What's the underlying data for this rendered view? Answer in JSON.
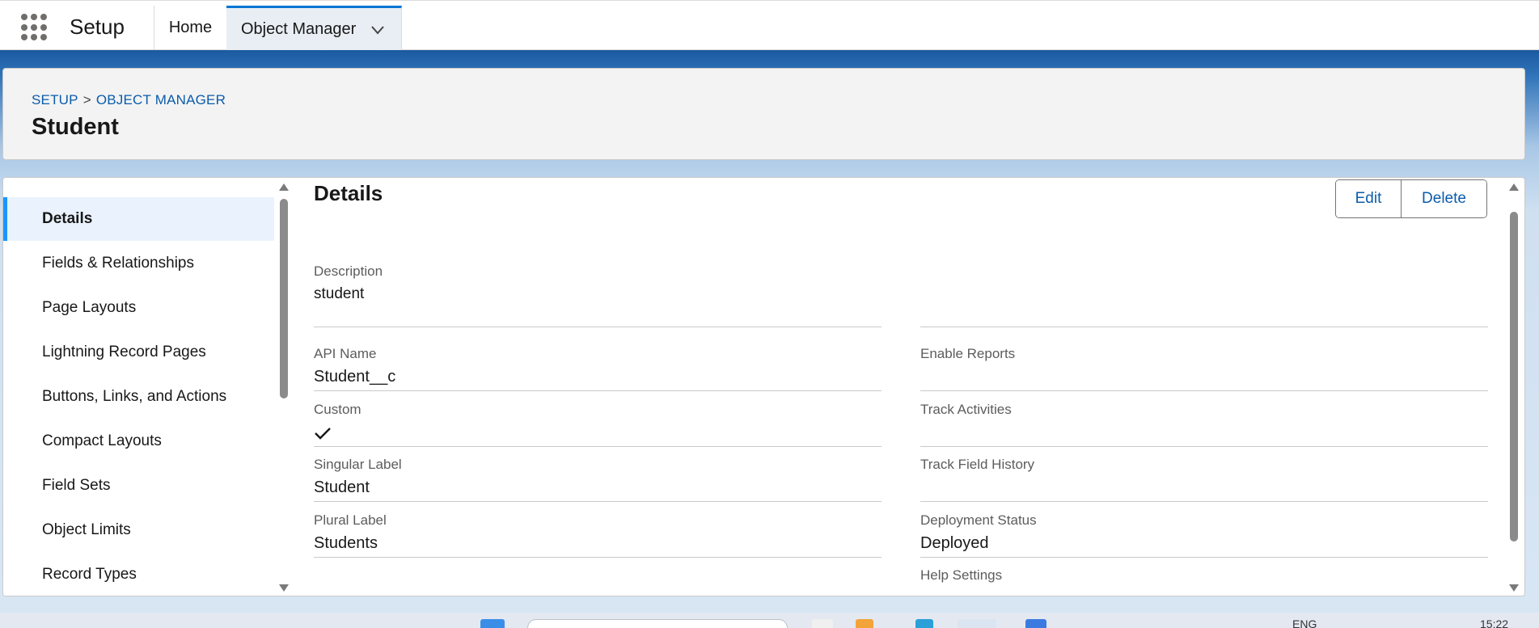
{
  "topbar": {
    "app_name": "Setup",
    "tabs": [
      {
        "label": "Home"
      },
      {
        "label": "Object Manager"
      }
    ]
  },
  "header": {
    "breadcrumb": [
      "SETUP",
      "OBJECT MANAGER"
    ],
    "breadcrumb_separator": ">",
    "title": "Student"
  },
  "sidebar": {
    "items": [
      {
        "label": "Details",
        "active": true
      },
      {
        "label": "Fields & Relationships"
      },
      {
        "label": "Page Layouts"
      },
      {
        "label": "Lightning Record Pages"
      },
      {
        "label": "Buttons, Links, and Actions"
      },
      {
        "label": "Compact Layouts"
      },
      {
        "label": "Field Sets"
      },
      {
        "label": "Object Limits"
      },
      {
        "label": "Record Types"
      }
    ]
  },
  "details": {
    "title": "Details",
    "edit_label": "Edit",
    "delete_label": "Delete",
    "description": {
      "label": "Description",
      "value": "student"
    },
    "left_fields": [
      {
        "label": "API Name",
        "value": "Student__c"
      },
      {
        "label": "Custom",
        "value": "",
        "checked": true
      },
      {
        "label": "Singular Label",
        "value": "Student"
      },
      {
        "label": "Plural Label",
        "value": "Students"
      }
    ],
    "right_fields": [
      {
        "label": "Enable Reports",
        "value": ""
      },
      {
        "label": "Track Activities",
        "value": ""
      },
      {
        "label": "Track Field History",
        "value": ""
      },
      {
        "label": "Deployment Status",
        "value": "Deployed"
      },
      {
        "label": "Help Settings",
        "value": ""
      }
    ]
  },
  "taskbar": {
    "lang": "ENG",
    "time": "15:22"
  },
  "colors": {
    "accent": "#0176d3",
    "link": "#0b5cab",
    "active_bg": "#eaf3fd"
  }
}
